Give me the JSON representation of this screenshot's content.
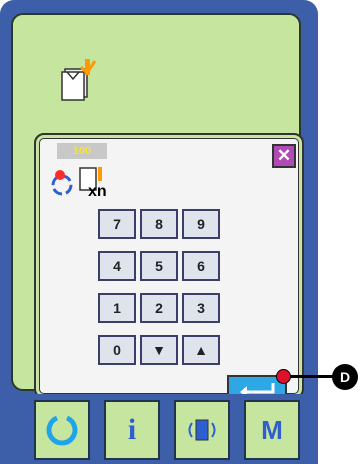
{
  "dialog": {
    "count_value": "100",
    "close_icon": "close-x-icon"
  },
  "numpad": {
    "keys": [
      "7",
      "8",
      "9",
      "4",
      "5",
      "6",
      "1",
      "2",
      "3",
      "0",
      "▼",
      "▲"
    ]
  },
  "enter_icon": "enter-arrow-icon",
  "footer": {
    "info_label": "i",
    "m_label": "M"
  },
  "callout": {
    "label": "D"
  },
  "colors": {
    "screen_bg": "#c6e6a0",
    "panel_blue": "#3d5ea8",
    "enter_blue": "#2da7e6",
    "close_purple": "#b04ab6",
    "callout_red": "#e0102a"
  }
}
